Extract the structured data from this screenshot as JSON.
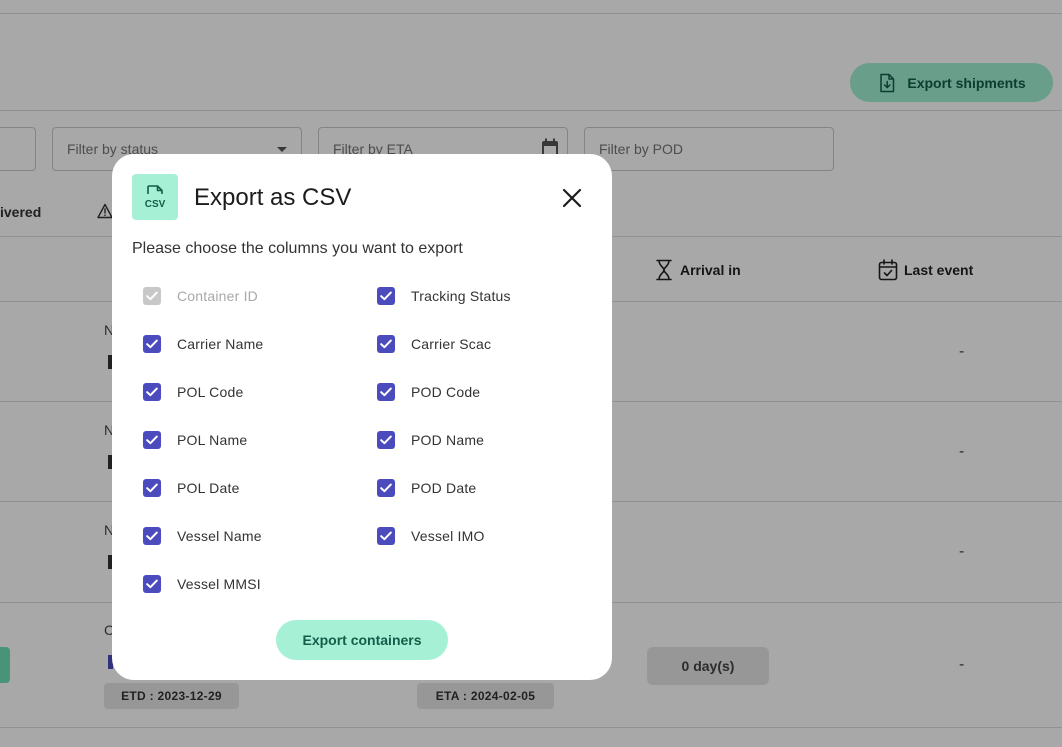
{
  "toolbar": {
    "export_shipments_label": "Export shipments"
  },
  "filters": {
    "status_placeholder": "Filter by status",
    "eta_placeholder": "Filter by ETA",
    "pod_placeholder": "Filter by POD"
  },
  "status_tabs": {
    "delivered_label": "ivered"
  },
  "table": {
    "headers": {
      "arrival_in": "Arrival in",
      "last_event": "Last event"
    },
    "rows": [
      {
        "prefix": "N",
        "last_event": "-"
      },
      {
        "prefix": "N",
        "last_event": "-"
      },
      {
        "prefix": "N",
        "last_event": "-"
      },
      {
        "prefix": "C",
        "etd": "ETD : 2023-12-29",
        "eta": "ETA : 2024-02-05",
        "arrival": "0 day(s)",
        "last_event": "-"
      }
    ]
  },
  "modal": {
    "icon_text": "CSV",
    "title": "Export as CSV",
    "subtitle": "Please choose the columns you want to export",
    "options": [
      {
        "label": "Container ID",
        "checked": true,
        "disabled": true
      },
      {
        "label": "Tracking Status",
        "checked": true,
        "disabled": false
      },
      {
        "label": "Carrier Name",
        "checked": true,
        "disabled": false
      },
      {
        "label": "Carrier Scac",
        "checked": true,
        "disabled": false
      },
      {
        "label": "POL Code",
        "checked": true,
        "disabled": false
      },
      {
        "label": "POD Code",
        "checked": true,
        "disabled": false
      },
      {
        "label": "POL Name",
        "checked": true,
        "disabled": false
      },
      {
        "label": "POD Name",
        "checked": true,
        "disabled": false
      },
      {
        "label": "POL Date",
        "checked": true,
        "disabled": false
      },
      {
        "label": "POD Date",
        "checked": true,
        "disabled": false
      },
      {
        "label": "Vessel Name",
        "checked": true,
        "disabled": false
      },
      {
        "label": "Vessel IMO",
        "checked": true,
        "disabled": false
      },
      {
        "label": "Vessel MMSI",
        "checked": true,
        "disabled": false
      }
    ],
    "export_button_label": "Export containers"
  },
  "colors": {
    "accent_green": "#a6f1d6",
    "accent_green_text": "#165c48",
    "checkbox_blue": "#4c4bbd",
    "checkbox_disabled": "#c8c8c8"
  },
  "icons": {
    "export_shipments": "file-download-icon",
    "modal": "csv-file-icon",
    "close": "close-icon",
    "arrival": "hourglass-icon",
    "last_event": "calendar-check-icon",
    "warning": "warning-icon"
  }
}
